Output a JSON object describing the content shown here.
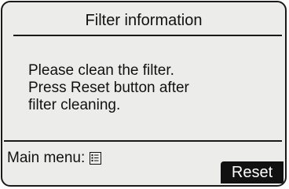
{
  "screen": {
    "title": "Filter information",
    "message_lines": [
      "Please clean the filter.",
      "Press Reset button after",
      "filter cleaning."
    ]
  },
  "footer": {
    "main_menu_label": "Main menu:",
    "main_menu_icon": "list-menu-icon",
    "reset_label": "Reset"
  },
  "colors": {
    "background": "#ececea",
    "ink": "#111111",
    "button_text": "#ffffff"
  }
}
